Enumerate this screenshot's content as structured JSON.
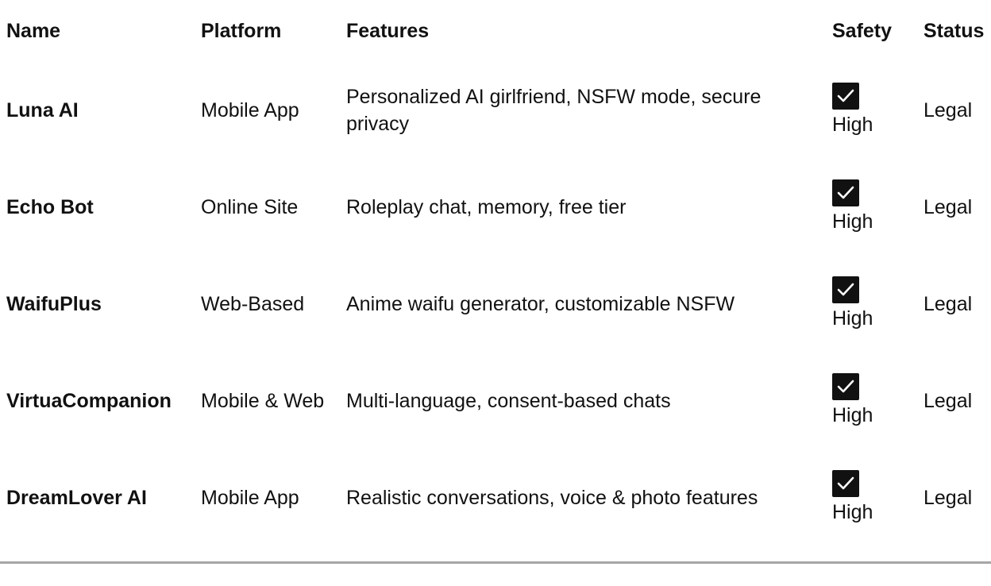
{
  "table": {
    "headers": {
      "name": "Name",
      "platform": "Platform",
      "features": "Features",
      "safety": "Safety",
      "status": "Status"
    },
    "rows": [
      {
        "name": "Luna AI",
        "platform": "Mobile App",
        "features": "Personalized AI girlfriend, NSFW mode, secure privacy",
        "safety_icon": "check-icon",
        "safety": "High",
        "status": "Legal"
      },
      {
        "name": "Echo Bot",
        "platform": "Online Site",
        "features": "Roleplay chat, memory, free tier",
        "safety_icon": "check-icon",
        "safety": "High",
        "status": "Legal"
      },
      {
        "name": "WaifuPlus",
        "platform": "Web-Based",
        "features": "Anime waifu generator, customizable NSFW",
        "safety_icon": "check-icon",
        "safety": "High",
        "status": "Legal"
      },
      {
        "name": "VirtuaCompanion",
        "platform": "Mobile & Web",
        "features": "Multi-language, consent-based chats",
        "safety_icon": "check-icon",
        "safety": "High",
        "status": "Legal"
      },
      {
        "name": "DreamLover AI",
        "platform": "Mobile App",
        "features": "Realistic conversations, voice & photo features",
        "safety_icon": "check-icon",
        "safety": "High",
        "status": "Legal"
      }
    ]
  },
  "colors": {
    "text": "#111111",
    "check_box": "#111111",
    "rule": "#a6a6a6"
  }
}
